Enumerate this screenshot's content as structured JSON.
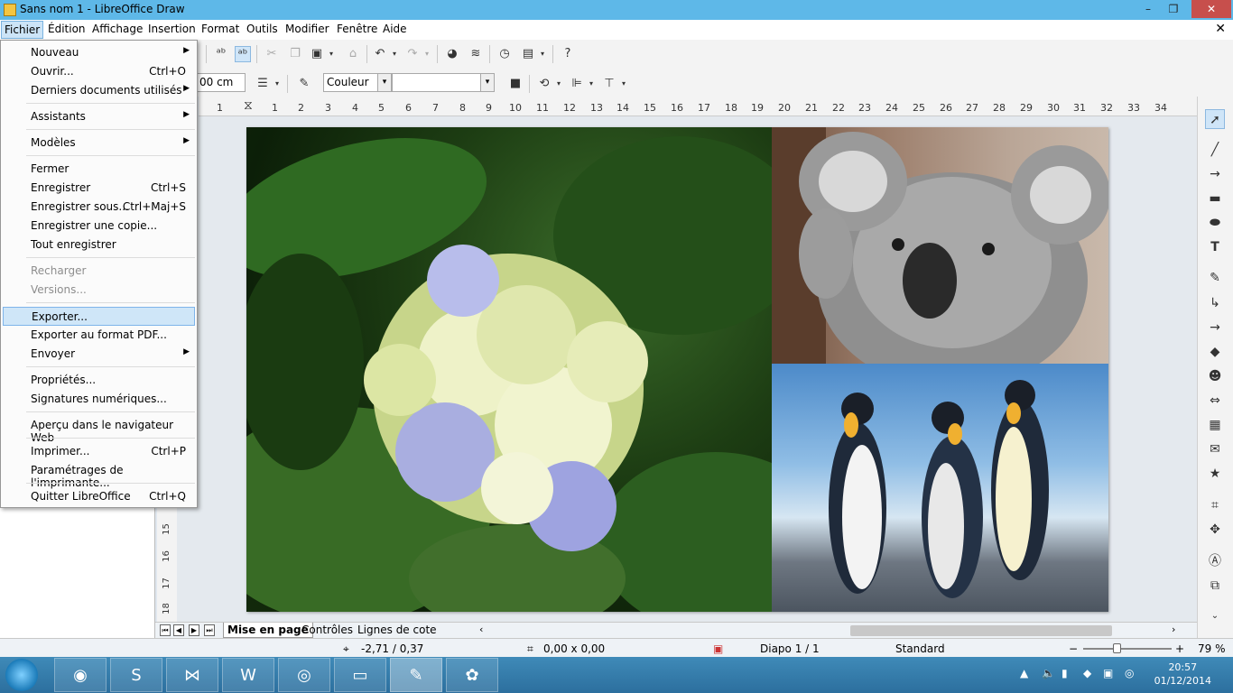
{
  "window": {
    "title": "Sans nom 1 - LibreOffice Draw",
    "controls": {
      "minimize": "–",
      "maximize": "❐",
      "close": "✕"
    }
  },
  "menubar": {
    "items": [
      "Fichier",
      "Édition",
      "Affichage",
      "Insertion",
      "Format",
      "Outils",
      "Modifier",
      "Fenêtre",
      "Aide"
    ],
    "doc_close": "✕"
  },
  "toolbar2": {
    "size_value": "00 cm",
    "fill_mode": "Couleur",
    "fill_value": ""
  },
  "ruler": {
    "h_ticks": [
      "1",
      "1",
      "2",
      "3",
      "4",
      "5",
      "6",
      "7",
      "8",
      "9",
      "10",
      "11",
      "12",
      "13",
      "14",
      "15",
      "16",
      "17",
      "18",
      "19",
      "20",
      "21",
      "22",
      "23",
      "24",
      "25",
      "26",
      "27",
      "28",
      "29",
      "30",
      "31",
      "32",
      "33",
      "34"
    ],
    "v_ticks": [
      "15",
      "16",
      "17",
      "18"
    ]
  },
  "file_menu": {
    "items": [
      {
        "label": "Nouveau",
        "shortcut": "",
        "submenu": true,
        "disabled": false
      },
      {
        "label": "Ouvrir...",
        "shortcut": "Ctrl+O",
        "submenu": false,
        "disabled": false
      },
      {
        "label": "Derniers documents utilisés",
        "shortcut": "",
        "submenu": true,
        "disabled": false
      },
      {
        "label": "Assistants",
        "shortcut": "",
        "submenu": true,
        "disabled": false
      },
      {
        "label": "Modèles",
        "shortcut": "",
        "submenu": true,
        "disabled": false
      },
      {
        "label": "Fermer",
        "shortcut": "",
        "submenu": false,
        "disabled": false
      },
      {
        "label": "Enregistrer",
        "shortcut": "Ctrl+S",
        "submenu": false,
        "disabled": false
      },
      {
        "label": "Enregistrer sous...",
        "shortcut": "Ctrl+Maj+S",
        "submenu": false,
        "disabled": false
      },
      {
        "label": "Enregistrer une copie...",
        "shortcut": "",
        "submenu": false,
        "disabled": false
      },
      {
        "label": "Tout enregistrer",
        "shortcut": "",
        "submenu": false,
        "disabled": false
      },
      {
        "label": "Recharger",
        "shortcut": "",
        "submenu": false,
        "disabled": true
      },
      {
        "label": "Versions...",
        "shortcut": "",
        "submenu": false,
        "disabled": true
      },
      {
        "label": "Exporter...",
        "shortcut": "",
        "submenu": false,
        "disabled": false,
        "highlighted": true
      },
      {
        "label": "Exporter au format PDF...",
        "shortcut": "",
        "submenu": false,
        "disabled": false
      },
      {
        "label": "Envoyer",
        "shortcut": "",
        "submenu": true,
        "disabled": false
      },
      {
        "label": "Propriétés...",
        "shortcut": "",
        "submenu": false,
        "disabled": false
      },
      {
        "label": "Signatures numériques...",
        "shortcut": "",
        "submenu": false,
        "disabled": false
      },
      {
        "label": "Aperçu dans le navigateur Web",
        "shortcut": "",
        "submenu": false,
        "disabled": false
      },
      {
        "label": "Imprimer...",
        "shortcut": "Ctrl+P",
        "submenu": false,
        "disabled": false
      },
      {
        "label": "Paramétrages de l'imprimante...",
        "shortcut": "",
        "submenu": false,
        "disabled": false
      },
      {
        "label": "Quitter LibreOffice",
        "shortcut": "Ctrl+Q",
        "submenu": false,
        "disabled": false
      }
    ]
  },
  "tabs": [
    "Mise en page",
    "Contrôles",
    "Lignes de cote"
  ],
  "statusbar": {
    "position": "-2,71 / 0,37",
    "size": "0,00 x 0,00",
    "slide": "Diapo 1 / 1",
    "layout": "Standard",
    "zoom": "79 %",
    "zoom_minus": "−",
    "zoom_plus": "+"
  },
  "taskbar": {
    "time": "20:57",
    "date": "01/12/2014"
  },
  "canvas": {
    "images": [
      "hydrangea-photo",
      "koala-photo",
      "penguins-photo"
    ]
  },
  "colors": {
    "titlebar": "#5eb8e8",
    "menu_highlight": "#cfe6f8",
    "taskbar": "#2c6f9e"
  }
}
